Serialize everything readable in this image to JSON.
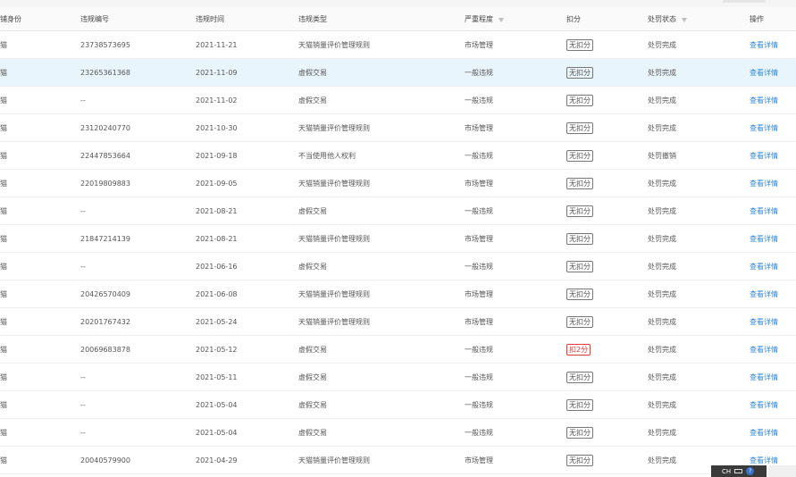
{
  "header": {
    "col0": "铺身份",
    "col1": "违规编号",
    "col2": "违规时间",
    "col3": "违规类型",
    "col4": "严重程度",
    "col5": "扣分",
    "col6": "处罚状态",
    "col7": "操作"
  },
  "rows": [
    {
      "shop": "猫",
      "id": "23738573695",
      "date": "2021-11-21",
      "type": "天猫销量评价管理规则",
      "severity": "市场管理",
      "points": "无扣分",
      "status": "处罚完成",
      "action": "查看详情"
    },
    {
      "shop": "猫",
      "id": "23265361368",
      "date": "2021-11-09",
      "type": "虚假交易",
      "severity": "一般违规",
      "points": "无扣分",
      "status": "处罚完成",
      "action": "查看详情"
    },
    {
      "shop": "猫",
      "id": "--",
      "date": "2021-11-02",
      "type": "虚假交易",
      "severity": "一般违规",
      "points": "无扣分",
      "status": "处罚完成",
      "action": "查看详情"
    },
    {
      "shop": "猫",
      "id": "23120240770",
      "date": "2021-10-30",
      "type": "天猫销量评价管理规则",
      "severity": "市场管理",
      "points": "无扣分",
      "status": "处罚完成",
      "action": "查看详情"
    },
    {
      "shop": "猫",
      "id": "22447853664",
      "date": "2021-09-18",
      "type": "不当使用他人权利",
      "severity": "一般违规",
      "points": "无扣分",
      "status": "处罚撤销",
      "action": "查看详情"
    },
    {
      "shop": "猫",
      "id": "22019809883",
      "date": "2021-09-05",
      "type": "天猫销量评价管理规则",
      "severity": "市场管理",
      "points": "无扣分",
      "status": "处罚完成",
      "action": "查看详情"
    },
    {
      "shop": "猫",
      "id": "--",
      "date": "2021-08-21",
      "type": "虚假交易",
      "severity": "一般违规",
      "points": "无扣分",
      "status": "处罚完成",
      "action": "查看详情"
    },
    {
      "shop": "猫",
      "id": "21847214139",
      "date": "2021-08-21",
      "type": "天猫销量评价管理规则",
      "severity": "市场管理",
      "points": "无扣分",
      "status": "处罚完成",
      "action": "查看详情"
    },
    {
      "shop": "猫",
      "id": "--",
      "date": "2021-06-16",
      "type": "虚假交易",
      "severity": "一般违规",
      "points": "无扣分",
      "status": "处罚完成",
      "action": "查看详情"
    },
    {
      "shop": "猫",
      "id": "20426570409",
      "date": "2021-06-08",
      "type": "天猫销量评价管理规则",
      "severity": "市场管理",
      "points": "无扣分",
      "status": "处罚完成",
      "action": "查看详情"
    },
    {
      "shop": "猫",
      "id": "20201767432",
      "date": "2021-05-24",
      "type": "天猫销量评价管理规则",
      "severity": "市场管理",
      "points": "无扣分",
      "status": "处罚完成",
      "action": "查看详情"
    },
    {
      "shop": "猫",
      "id": "20069683878",
      "date": "2021-05-12",
      "type": "虚假交易",
      "severity": "一般违规",
      "points": "扣2分",
      "status": "处罚完成",
      "action": "查看详情"
    },
    {
      "shop": "猫",
      "id": "--",
      "date": "2021-05-11",
      "type": "虚假交易",
      "severity": "一般违规",
      "points": "无扣分",
      "status": "处罚完成",
      "action": "查看详情"
    },
    {
      "shop": "猫",
      "id": "--",
      "date": "2021-05-04",
      "type": "虚假交易",
      "severity": "一般违规",
      "points": "无扣分",
      "status": "处罚完成",
      "action": "查看详情"
    },
    {
      "shop": "猫",
      "id": "--",
      "date": "2021-05-04",
      "type": "虚假交易",
      "severity": "一般违规",
      "points": "无扣分",
      "status": "处罚完成",
      "action": "查看详情"
    },
    {
      "shop": "猫",
      "id": "20040579900",
      "date": "2021-04-29",
      "type": "天猫销量评价管理规则",
      "severity": "市场管理",
      "points": "无扣分",
      "status": "处罚完成",
      "action": "查看详情"
    }
  ],
  "highlight_row": 1,
  "taskbar": {
    "ime_label": "CH"
  },
  "colors": {
    "link": "#2d86d6",
    "highlight": "#e9f5fc",
    "deduct": "#e23a3a"
  }
}
